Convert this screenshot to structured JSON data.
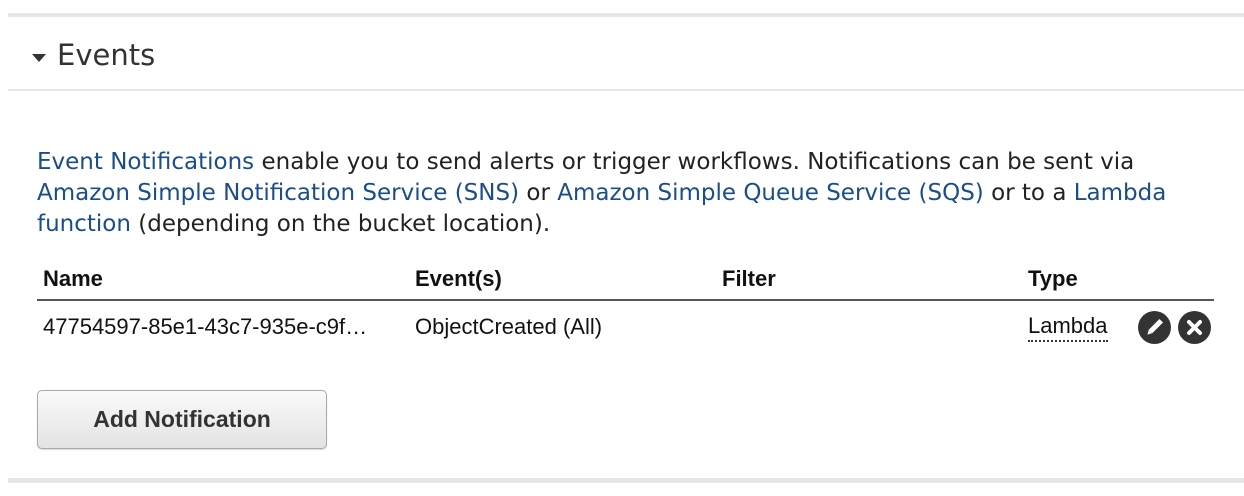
{
  "section": {
    "title": "Events"
  },
  "description": {
    "link1": "Event Notifications",
    "text1": " enable you to send alerts or trigger workflows. Notifications can be sent via ",
    "link2": "Amazon Simple Notification Service (SNS)",
    "text2": " or ",
    "link3": "Amazon Simple Queue Service (SQS)",
    "text3": " or to a ",
    "link4": "Lambda function",
    "text4": " (depending on the bucket location)."
  },
  "table": {
    "headers": {
      "name": "Name",
      "events": "Event(s)",
      "filter": "Filter",
      "type": "Type"
    },
    "rows": [
      {
        "name": "47754597-85e1-43c7-935e-c9f…",
        "events": "ObjectCreated (All)",
        "filter": "",
        "type": "Lambda",
        "edit_icon": "pencil-icon",
        "delete_icon": "close-icon"
      }
    ]
  },
  "actions": {
    "add_label": "Add Notification"
  },
  "colors": {
    "link": "#1a4e8a",
    "icon_bg": "#333333",
    "border": "#e6e6e6"
  }
}
